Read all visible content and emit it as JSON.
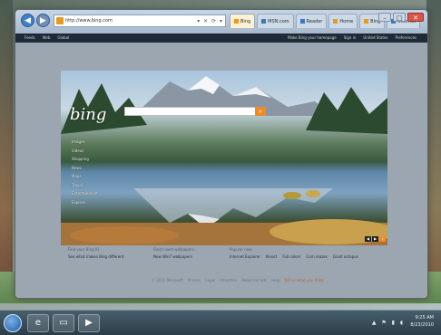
{
  "browser": {
    "nav_back": "◀",
    "nav_forward": "▶",
    "address": "http://www.bing.com",
    "address_tools": "▾ ✕ ⟳ ▾",
    "tabs": [
      {
        "label": "Bing",
        "active": true
      },
      {
        "label": "MSN.com",
        "active": false
      },
      {
        "label": "Reader",
        "active": false
      },
      {
        "label": "Home",
        "active": false
      },
      {
        "label": "Bing",
        "active": false
      },
      {
        "label": "Internet",
        "active": false
      }
    ],
    "window_controls": {
      "minimize": "–",
      "maximize": "□",
      "close": "✕"
    }
  },
  "commandbar": {
    "left": [
      "Feeds",
      "Web",
      "Global"
    ],
    "right": [
      "Make Bing your homepage",
      "Sign in",
      "United States",
      "Preferences"
    ]
  },
  "bing": {
    "logo": "bing",
    "search_placeholder": "",
    "search_icon": "⌕",
    "nav": [
      "Images",
      "Videos",
      "Shopping",
      "News",
      "Maps",
      "Travel",
      "Entertainment",
      "Explore"
    ],
    "arrows": {
      "prev": "◀",
      "next": "▶",
      "info": "i"
    }
  },
  "promos": {
    "col1_head": "Find your Bing IQ",
    "col1_body": "See what makes Bing different",
    "col2_head": "Bing's best wallpapers",
    "col2_body": "New Win7 wallpapers",
    "col3_head": "Popular now",
    "col3_items": [
      "Internet Explorer",
      "Kinect",
      "Full colors",
      "Corn mazes",
      "Giant octopus"
    ]
  },
  "footer": {
    "items": [
      "© 2010 Microsoft",
      "Privacy",
      "Legal",
      "Advertise",
      "About our ads",
      "Help"
    ],
    "feedback": "Tell us what you think"
  },
  "taskbar": {
    "ie_icon": "e",
    "folder_icon": "▭",
    "media_icon": "▶",
    "time": "9:25 AM",
    "date": "8/23/2010",
    "tray_icons": "▲ ⚑ ▮ ◖"
  },
  "colors": {
    "accent": "#f08a24",
    "window_chrome": "#a6b8cc",
    "page_background": "#9ba6b1"
  }
}
